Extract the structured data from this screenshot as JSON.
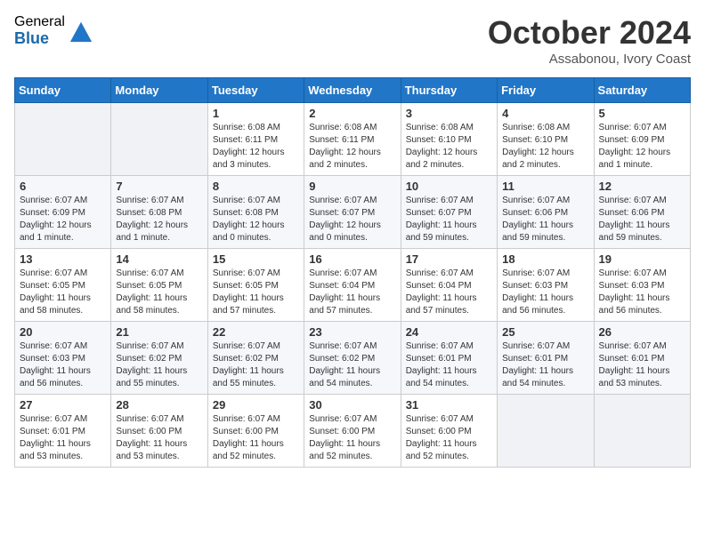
{
  "logo": {
    "general": "General",
    "blue": "Blue"
  },
  "title": "October 2024",
  "location": "Assabonou, Ivory Coast",
  "days_header": [
    "Sunday",
    "Monday",
    "Tuesday",
    "Wednesday",
    "Thursday",
    "Friday",
    "Saturday"
  ],
  "weeks": [
    [
      {
        "day": "",
        "info": ""
      },
      {
        "day": "",
        "info": ""
      },
      {
        "day": "1",
        "info": "Sunrise: 6:08 AM\nSunset: 6:11 PM\nDaylight: 12 hours and 3 minutes."
      },
      {
        "day": "2",
        "info": "Sunrise: 6:08 AM\nSunset: 6:11 PM\nDaylight: 12 hours and 2 minutes."
      },
      {
        "day": "3",
        "info": "Sunrise: 6:08 AM\nSunset: 6:10 PM\nDaylight: 12 hours and 2 minutes."
      },
      {
        "day": "4",
        "info": "Sunrise: 6:08 AM\nSunset: 6:10 PM\nDaylight: 12 hours and 2 minutes."
      },
      {
        "day": "5",
        "info": "Sunrise: 6:07 AM\nSunset: 6:09 PM\nDaylight: 12 hours and 1 minute."
      }
    ],
    [
      {
        "day": "6",
        "info": "Sunrise: 6:07 AM\nSunset: 6:09 PM\nDaylight: 12 hours and 1 minute."
      },
      {
        "day": "7",
        "info": "Sunrise: 6:07 AM\nSunset: 6:08 PM\nDaylight: 12 hours and 1 minute."
      },
      {
        "day": "8",
        "info": "Sunrise: 6:07 AM\nSunset: 6:08 PM\nDaylight: 12 hours and 0 minutes."
      },
      {
        "day": "9",
        "info": "Sunrise: 6:07 AM\nSunset: 6:07 PM\nDaylight: 12 hours and 0 minutes."
      },
      {
        "day": "10",
        "info": "Sunrise: 6:07 AM\nSunset: 6:07 PM\nDaylight: 11 hours and 59 minutes."
      },
      {
        "day": "11",
        "info": "Sunrise: 6:07 AM\nSunset: 6:06 PM\nDaylight: 11 hours and 59 minutes."
      },
      {
        "day": "12",
        "info": "Sunrise: 6:07 AM\nSunset: 6:06 PM\nDaylight: 11 hours and 59 minutes."
      }
    ],
    [
      {
        "day": "13",
        "info": "Sunrise: 6:07 AM\nSunset: 6:05 PM\nDaylight: 11 hours and 58 minutes."
      },
      {
        "day": "14",
        "info": "Sunrise: 6:07 AM\nSunset: 6:05 PM\nDaylight: 11 hours and 58 minutes."
      },
      {
        "day": "15",
        "info": "Sunrise: 6:07 AM\nSunset: 6:05 PM\nDaylight: 11 hours and 57 minutes."
      },
      {
        "day": "16",
        "info": "Sunrise: 6:07 AM\nSunset: 6:04 PM\nDaylight: 11 hours and 57 minutes."
      },
      {
        "day": "17",
        "info": "Sunrise: 6:07 AM\nSunset: 6:04 PM\nDaylight: 11 hours and 57 minutes."
      },
      {
        "day": "18",
        "info": "Sunrise: 6:07 AM\nSunset: 6:03 PM\nDaylight: 11 hours and 56 minutes."
      },
      {
        "day": "19",
        "info": "Sunrise: 6:07 AM\nSunset: 6:03 PM\nDaylight: 11 hours and 56 minutes."
      }
    ],
    [
      {
        "day": "20",
        "info": "Sunrise: 6:07 AM\nSunset: 6:03 PM\nDaylight: 11 hours and 56 minutes."
      },
      {
        "day": "21",
        "info": "Sunrise: 6:07 AM\nSunset: 6:02 PM\nDaylight: 11 hours and 55 minutes."
      },
      {
        "day": "22",
        "info": "Sunrise: 6:07 AM\nSunset: 6:02 PM\nDaylight: 11 hours and 55 minutes."
      },
      {
        "day": "23",
        "info": "Sunrise: 6:07 AM\nSunset: 6:02 PM\nDaylight: 11 hours and 54 minutes."
      },
      {
        "day": "24",
        "info": "Sunrise: 6:07 AM\nSunset: 6:01 PM\nDaylight: 11 hours and 54 minutes."
      },
      {
        "day": "25",
        "info": "Sunrise: 6:07 AM\nSunset: 6:01 PM\nDaylight: 11 hours and 54 minutes."
      },
      {
        "day": "26",
        "info": "Sunrise: 6:07 AM\nSunset: 6:01 PM\nDaylight: 11 hours and 53 minutes."
      }
    ],
    [
      {
        "day": "27",
        "info": "Sunrise: 6:07 AM\nSunset: 6:01 PM\nDaylight: 11 hours and 53 minutes."
      },
      {
        "day": "28",
        "info": "Sunrise: 6:07 AM\nSunset: 6:00 PM\nDaylight: 11 hours and 53 minutes."
      },
      {
        "day": "29",
        "info": "Sunrise: 6:07 AM\nSunset: 6:00 PM\nDaylight: 11 hours and 52 minutes."
      },
      {
        "day": "30",
        "info": "Sunrise: 6:07 AM\nSunset: 6:00 PM\nDaylight: 11 hours and 52 minutes."
      },
      {
        "day": "31",
        "info": "Sunrise: 6:07 AM\nSunset: 6:00 PM\nDaylight: 11 hours and 52 minutes."
      },
      {
        "day": "",
        "info": ""
      },
      {
        "day": "",
        "info": ""
      }
    ]
  ]
}
